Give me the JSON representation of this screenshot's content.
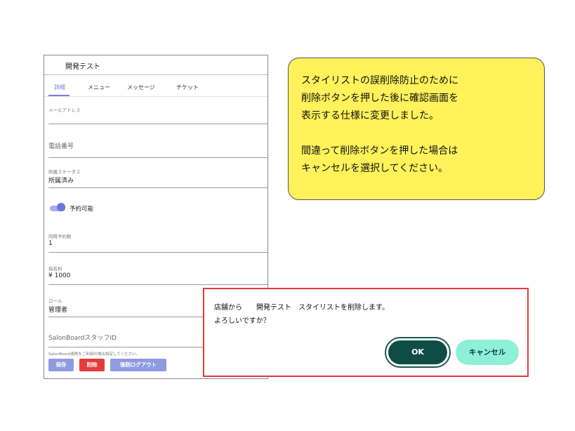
{
  "panel": {
    "title": "開発テスト",
    "tabs": [
      "詳細",
      "メニュー",
      "メッセージ",
      "チケット"
    ],
    "active_tab": 0,
    "fields": {
      "email": {
        "label": "メールアドレス",
        "value": ""
      },
      "phone": {
        "placeholder": "電話番号"
      },
      "status": {
        "label": "所属ステータス",
        "value": "所属済み"
      },
      "reservable": {
        "label": "予約可能",
        "on": true
      },
      "concurrent": {
        "label": "同時予約数",
        "value": "1"
      },
      "nomination_fee": {
        "label": "指名料",
        "value": "¥ 1000"
      },
      "role": {
        "label": "ロール",
        "value": "管理者"
      },
      "salonboard": {
        "placeholder": "SalonBoardスタッフID",
        "helper": "SalonBoard連携をご利用の場合設定してください。"
      }
    },
    "buttons": {
      "save": "保存",
      "delete": "削除",
      "force_logout": "強制ログアウト"
    },
    "colors": {
      "accent": "#7b7fd9",
      "save": "#8f9be0",
      "delete": "#e53b3b",
      "force_logout": "#8f9be0"
    }
  },
  "callout": {
    "lines": [
      "スタイリストの誤削除防止のために",
      "削除ボタンを押した後に確認画面を",
      "表示する仕様に変更しました。",
      "",
      "間違って削除ボタンを押した場合は",
      "キャンセルを選択してください。"
    ],
    "color": "#fff25a"
  },
  "dialog": {
    "message_line1": "店舗から　　開発テスト　スタイリストを削除します。",
    "message_line2": "よろしいですか？",
    "ok_label": "OK",
    "cancel_label": "キャンセル",
    "border_color": "#e23a3a"
  }
}
